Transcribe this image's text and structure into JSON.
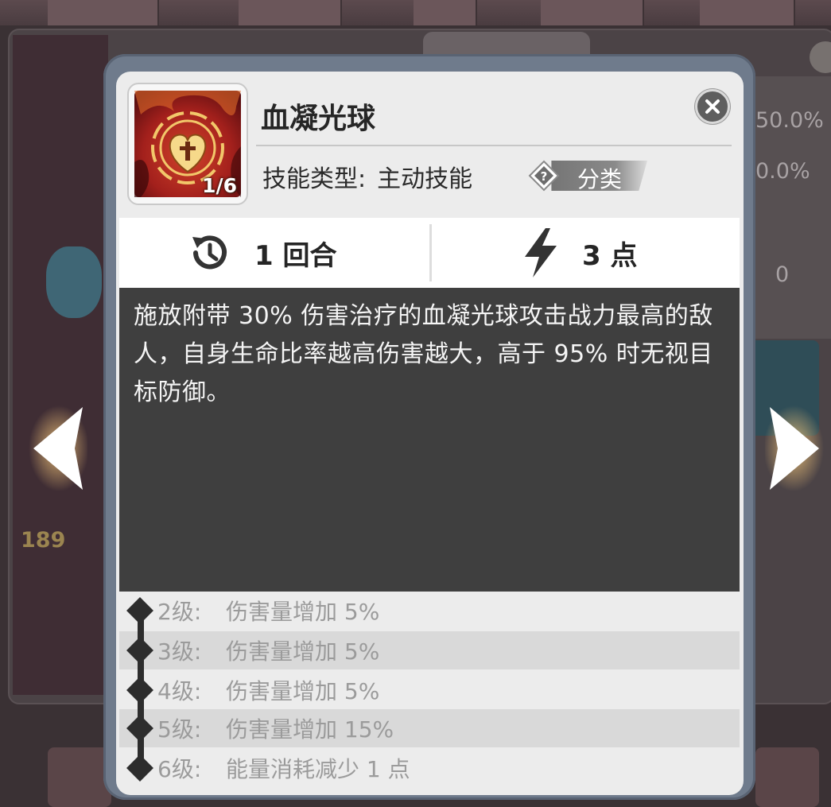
{
  "skill": {
    "name": "血凝光球",
    "rank": "1/6",
    "type_label": "技能类型:",
    "type_value": "主动技能",
    "category_label": "分类",
    "cooldown": "1 回合",
    "cost": "3 点",
    "description": "施放附带 30% 伤害治疗的血凝光球攻击战力最高的敌人，自身生命比率越高伤害越大，高于 95% 时无视目标防御。"
  },
  "levels": [
    {
      "level": "2级:",
      "effect": "伤害量增加 5%"
    },
    {
      "level": "3级:",
      "effect": "伤害量增加 5%"
    },
    {
      "level": "4级:",
      "effect": "伤害量增加 5%"
    },
    {
      "level": "5级:",
      "effect": "伤害量增加 15%"
    },
    {
      "level": "6级:",
      "effect": "能量消耗减少 1 点"
    }
  ],
  "background": {
    "stat_1": "50.0%",
    "stat_2": "0.0%",
    "stat_3": "0",
    "power": "189"
  },
  "icons": {
    "skill": "heart-cross-emblem-icon",
    "close": "close-icon",
    "cooldown": "clock-rewind-icon",
    "energy": "lightning-bolt-icon",
    "help": "question-mark-icon",
    "nav_left": "arrow-left-icon",
    "nav_right": "arrow-right-icon"
  },
  "colors": {
    "skill_bg": "#a3201c",
    "description_bg": "#3f3f3f",
    "modal_frame": "#6f7b8c"
  }
}
